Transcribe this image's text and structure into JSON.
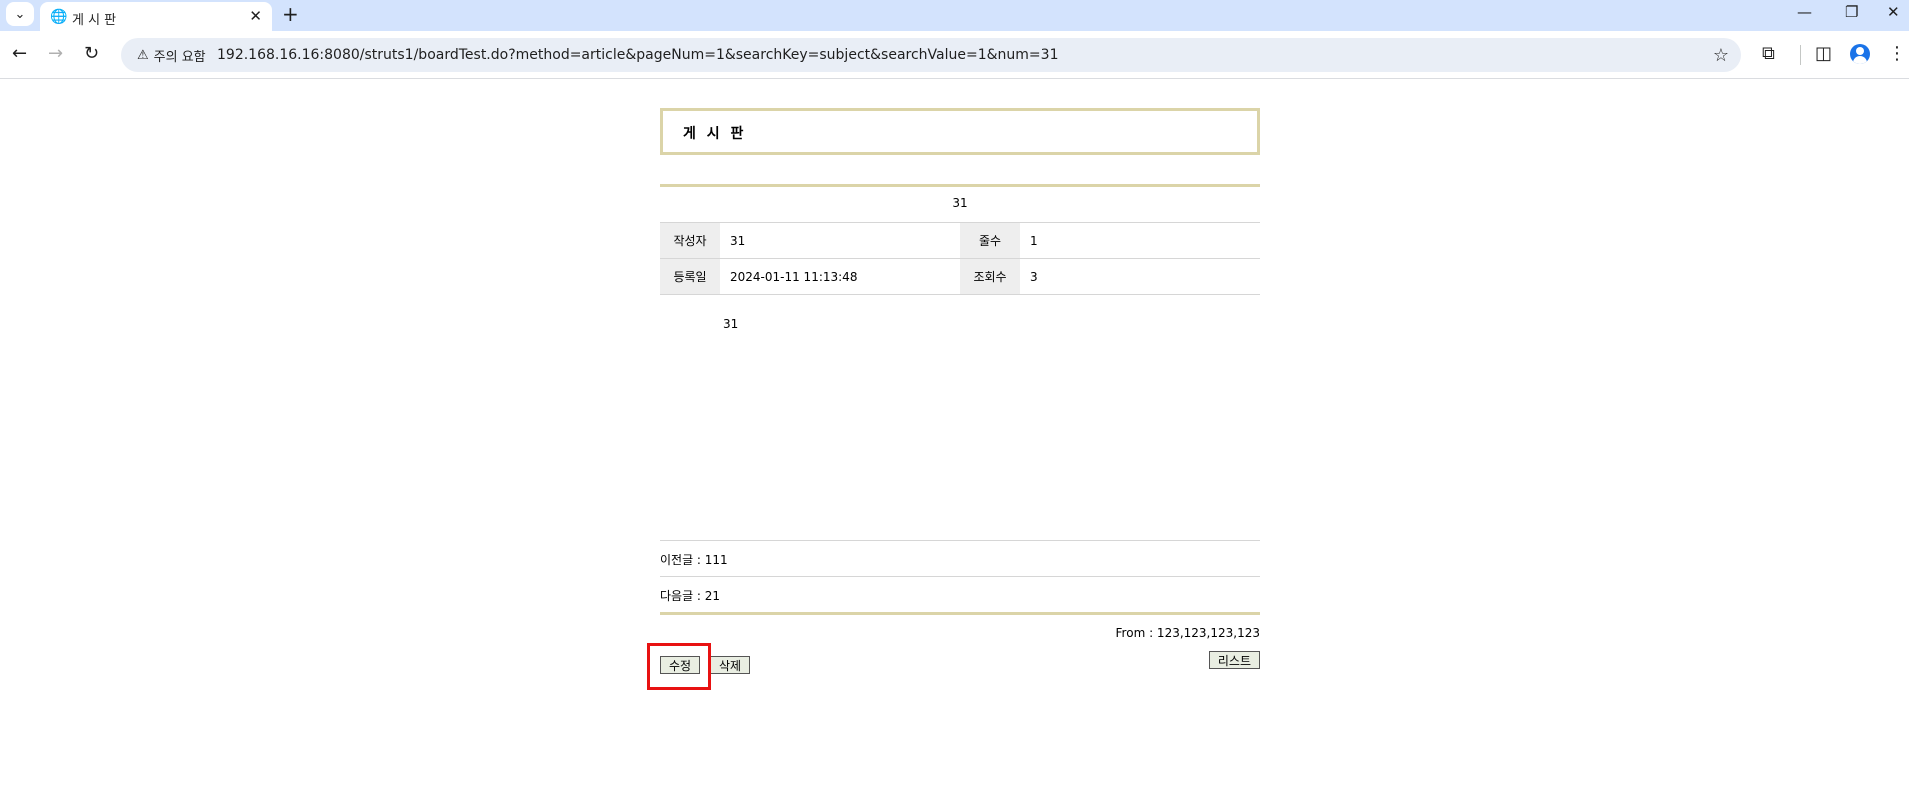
{
  "browser": {
    "tab_title": "게 시 판",
    "security_label": "주의 요함",
    "url": "192.168.16.16:8080/struts1/boardTest.do?method=article&pageNum=1&searchKey=subject&searchValue=1&num=31"
  },
  "board": {
    "title": "게 시 판",
    "subject": "31",
    "meta": {
      "writer_label": "작성자",
      "writer_value": "31",
      "lines_label": "줄수",
      "lines_value": "1",
      "date_label": "등록일",
      "date_value": "2024-01-11 11:13:48",
      "views_label": "조회수",
      "views_value": "3"
    },
    "content": "31",
    "prev": "이전글 : 111",
    "next": "다음글 : 21",
    "from": "From : 123,123,123,123"
  },
  "buttons": {
    "edit": "수정",
    "delete": "삭제",
    "list": "리스트"
  },
  "colors": {
    "tabbar": "#d3e3fd",
    "board_border": "#dbd4a8",
    "highlight": "#e81111"
  }
}
